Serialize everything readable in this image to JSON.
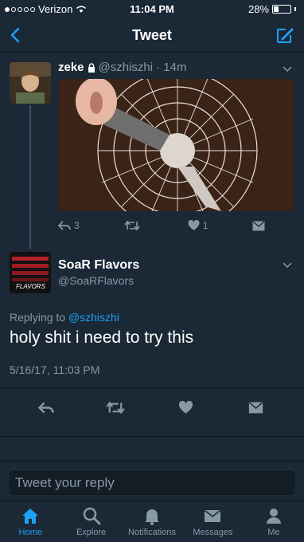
{
  "status": {
    "carrier": "Verizon",
    "time": "11:04 PM",
    "battery": "28%",
    "battery_level": 0.28
  },
  "nav": {
    "title": "Tweet"
  },
  "tweet1": {
    "name": "zeke",
    "handle": "@szhiszhi",
    "time": "· 14m",
    "reply_count": "3",
    "retweet_count": "",
    "like_count": "1"
  },
  "tweet2": {
    "name": "SoaR Flavors",
    "handle": "@SoaRFlavors",
    "avatar_text": "FLAVORS",
    "replying_prefix": "Replying to",
    "replying_handle": "@szhiszhi",
    "text": "holy shit i need to try this",
    "date": "5/16/17, 11:03 PM"
  },
  "reply": {
    "placeholder": "Tweet your reply"
  },
  "tabs": [
    {
      "label": "Home",
      "icon": "home-icon",
      "active": true
    },
    {
      "label": "Explore",
      "icon": "search-icon"
    },
    {
      "label": "Notifications",
      "icon": "bell-icon"
    },
    {
      "label": "Messages",
      "icon": "envelope-icon"
    },
    {
      "label": "Me",
      "icon": "person-icon"
    }
  ],
  "colors": {
    "accent": "#1da1f2",
    "background": "#1b2836",
    "muted": "#8899a6"
  }
}
